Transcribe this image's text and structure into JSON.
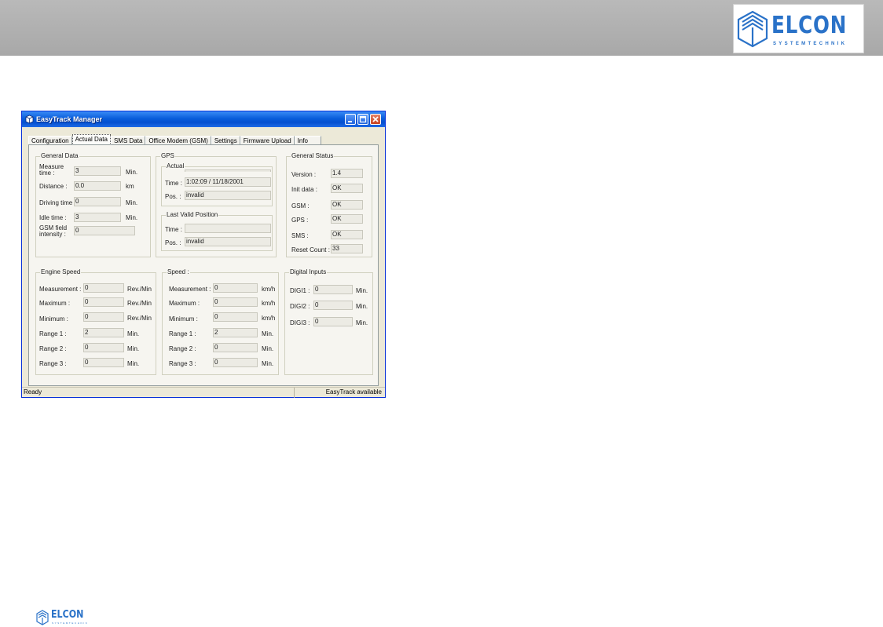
{
  "slide": {
    "logo_text": "ELCON",
    "logo_sub": "SYSTEMTECHNIK"
  },
  "window": {
    "title": "EasyTrack Manager",
    "tabs": [
      "Configuration",
      "Actual Data",
      "SMS Data",
      "Office Modem (GSM)",
      "Settings",
      "Firmware Upload",
      "Info"
    ],
    "active_tab": "Actual Data"
  },
  "general_data": {
    "title": "General Data",
    "measure_time": {
      "label_1": "Measure",
      "label_2": "time :",
      "value": "3",
      "unit": "Min."
    },
    "distance": {
      "label": "Distance :",
      "value": "0.0",
      "unit": "km"
    },
    "driving_time": {
      "label": "Driving time :",
      "value": "0",
      "unit": "Min."
    },
    "idle_time": {
      "label": "Idle time :",
      "value": "3",
      "unit": "Min."
    },
    "gsm_field": {
      "label_1": "GSM field",
      "label_2": "intensity :",
      "value": "0"
    }
  },
  "gps": {
    "title": "GPS",
    "actual": {
      "title": "Actual",
      "time_label": "Time :",
      "time_value": "1:02:09 / 11/18/2001",
      "pos_label": "Pos. :",
      "pos_value": "invalid"
    },
    "last_valid": {
      "title": "Last Valid Position",
      "time_label": "Time :",
      "time_value": "",
      "pos_label": "Pos. :",
      "pos_value": "invalid"
    }
  },
  "general_status": {
    "title": "General Status",
    "rows": [
      {
        "label": "Version :",
        "value": "1.4"
      },
      {
        "label": "Init data :",
        "value": "OK"
      },
      {
        "label": "GSM :",
        "value": "OK"
      },
      {
        "label": "GPS :",
        "value": "OK"
      },
      {
        "label": "SMS :",
        "value": "OK"
      },
      {
        "label": "Reset Count :",
        "value": "33"
      }
    ]
  },
  "engine_speed": {
    "title": "Engine Speed",
    "rows": [
      {
        "label": "Measurement :",
        "value": "0",
        "unit": "Rev./Min"
      },
      {
        "label": "Maximum :",
        "value": "0",
        "unit": "Rev./Min"
      },
      {
        "label": "Minimum :",
        "value": "0",
        "unit": "Rev./Min"
      },
      {
        "label": "Range 1 :",
        "value": "2",
        "unit": "Min."
      },
      {
        "label": "Range 2 :",
        "value": "0",
        "unit": "Min."
      },
      {
        "label": "Range 3 :",
        "value": "0",
        "unit": "Min."
      }
    ]
  },
  "speed": {
    "title": "Speed :",
    "rows": [
      {
        "label": "Measurement :",
        "value": "0",
        "unit": "km/h"
      },
      {
        "label": "Maximum :",
        "value": "0",
        "unit": "km/h"
      },
      {
        "label": "Minimum :",
        "value": "0",
        "unit": "km/h"
      },
      {
        "label": "Range 1 :",
        "value": "2",
        "unit": "Min."
      },
      {
        "label": "Range 2 :",
        "value": "0",
        "unit": "Min."
      },
      {
        "label": "Range 3 :",
        "value": "0",
        "unit": "Min."
      }
    ]
  },
  "digital_inputs": {
    "title": "Digital Inputs",
    "rows": [
      {
        "label": "DIGI1 :",
        "value": "0",
        "unit": "Min."
      },
      {
        "label": "DIGI2 :",
        "value": "0",
        "unit": "Min."
      },
      {
        "label": "DIGI3 :",
        "value": "0",
        "unit": "Min."
      }
    ]
  },
  "status_bar": {
    "left": "Ready",
    "right": "EasyTrack available"
  },
  "colors": {
    "brand_blue": "#2a72c8",
    "titlebar_blue": "#0550d0",
    "close_red": "#c8421f"
  }
}
